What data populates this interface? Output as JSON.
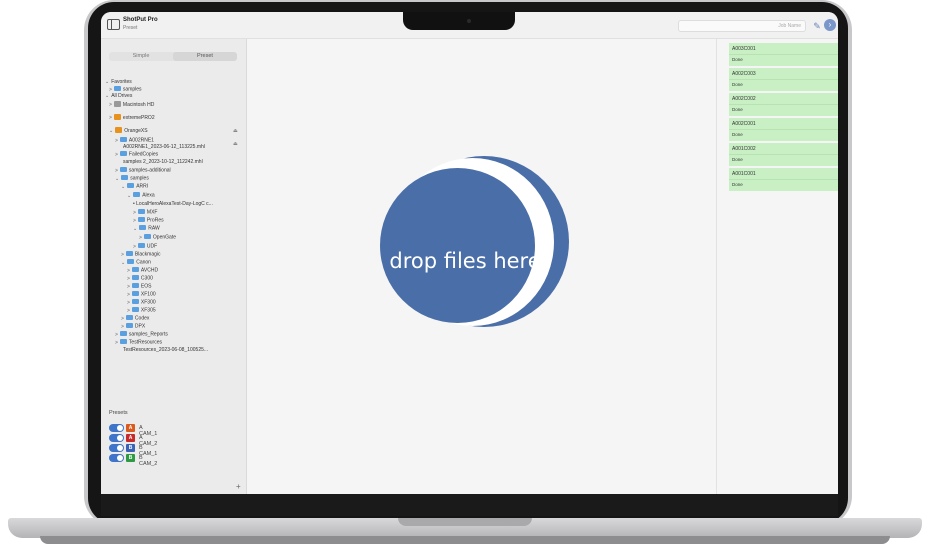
{
  "app": {
    "title": "ShotPut Pro",
    "subtitle": "Preset"
  },
  "header": {
    "job_name_placeholder": "Job Name"
  },
  "sidebar": {
    "tabs": [
      {
        "label": "Simple"
      },
      {
        "label": "Preset"
      }
    ],
    "tree": [
      {
        "label": "Favorites",
        "chev": "⌄",
        "type": "none"
      },
      {
        "label": "samples",
        "chev": ">",
        "type": "folder"
      },
      {
        "label": "All Drives",
        "chev": "⌄",
        "type": "none"
      },
      {
        "label": "Macintosh HD",
        "chev": ">",
        "type": "drive"
      },
      {
        "label": "extremePRO2",
        "chev": ">",
        "type": "drive-or"
      },
      {
        "label": "OrangeXS",
        "chev": "⌄",
        "type": "drive-or"
      },
      {
        "label": "A002RNE1",
        "chev": ">",
        "type": "folder"
      },
      {
        "label": "A002RNE1_2023-06-12_113225.mhl",
        "chev": "",
        "type": "none"
      },
      {
        "label": "FailedCopies",
        "chev": ">",
        "type": "folder"
      },
      {
        "label": "samples 2_2023-10-12_112242.mhl",
        "chev": "",
        "type": "none"
      },
      {
        "label": "samples-additional",
        "chev": ">",
        "type": "folder"
      },
      {
        "label": "samples",
        "chev": "⌄",
        "type": "folder"
      },
      {
        "label": "ARRI",
        "chev": "⌄",
        "type": "folder"
      },
      {
        "label": "Alexa",
        "chev": "⌄",
        "type": "folder"
      },
      {
        "label": "LocalHeroAlexaTest-Day-LogC c...",
        "chev": "",
        "type": "dot"
      },
      {
        "label": "MXF",
        "chev": ">",
        "type": "folder"
      },
      {
        "label": "ProRes",
        "chev": ">",
        "type": "folder"
      },
      {
        "label": "RAW",
        "chev": "⌄",
        "type": "folder"
      },
      {
        "label": "OpenGate",
        "chev": ">",
        "type": "folder"
      },
      {
        "label": "UDF",
        "chev": ">",
        "type": "folder"
      },
      {
        "label": "Blackmagic",
        "chev": ">",
        "type": "folder"
      },
      {
        "label": "Canon",
        "chev": "⌄",
        "type": "folder"
      },
      {
        "label": "AVCHD",
        "chev": ">",
        "type": "folder"
      },
      {
        "label": "C300",
        "chev": ">",
        "type": "folder"
      },
      {
        "label": "EOS",
        "chev": ">",
        "type": "folder"
      },
      {
        "label": "XF100",
        "chev": ">",
        "type": "folder"
      },
      {
        "label": "XF300",
        "chev": ">",
        "type": "folder"
      },
      {
        "label": "XF305",
        "chev": ">",
        "type": "folder"
      },
      {
        "label": "Codex",
        "chev": ">",
        "type": "folder"
      },
      {
        "label": "DPX",
        "chev": ">",
        "type": "folder"
      },
      {
        "label": "samples_Reports",
        "chev": ">",
        "type": "folder"
      },
      {
        "label": "TestResources",
        "chev": ">",
        "type": "folder"
      },
      {
        "label": "TestResources_2023-06-08_100525...",
        "chev": "",
        "type": "none"
      }
    ],
    "presets_label": "Presets",
    "presets": [
      {
        "badge": "A",
        "label": "A CAM_1",
        "color": "#d95b1e"
      },
      {
        "badge": "A",
        "label": "A CAM_2",
        "color": "#c62a2a"
      },
      {
        "badge": "B",
        "label": "B CAM_1",
        "color": "#3a63b8"
      },
      {
        "badge": "B",
        "label": "B CAM_2",
        "color": "#2f9a44"
      }
    ],
    "add_label": "+"
  },
  "dropzone": {
    "label": "drop files here"
  },
  "jobs": [
    {
      "name": "A003C001",
      "status": "Done"
    },
    {
      "name": "A002C003",
      "status": "Done"
    },
    {
      "name": "A002C002",
      "status": "Done"
    },
    {
      "name": "A002C001",
      "status": "Done"
    },
    {
      "name": "A001C002",
      "status": "Done"
    },
    {
      "name": "A001C001",
      "status": "Done"
    }
  ],
  "colors": {
    "accent": "#4a6ea8",
    "job_done": "#c9f0c4",
    "toggle": "#3e74c9"
  }
}
